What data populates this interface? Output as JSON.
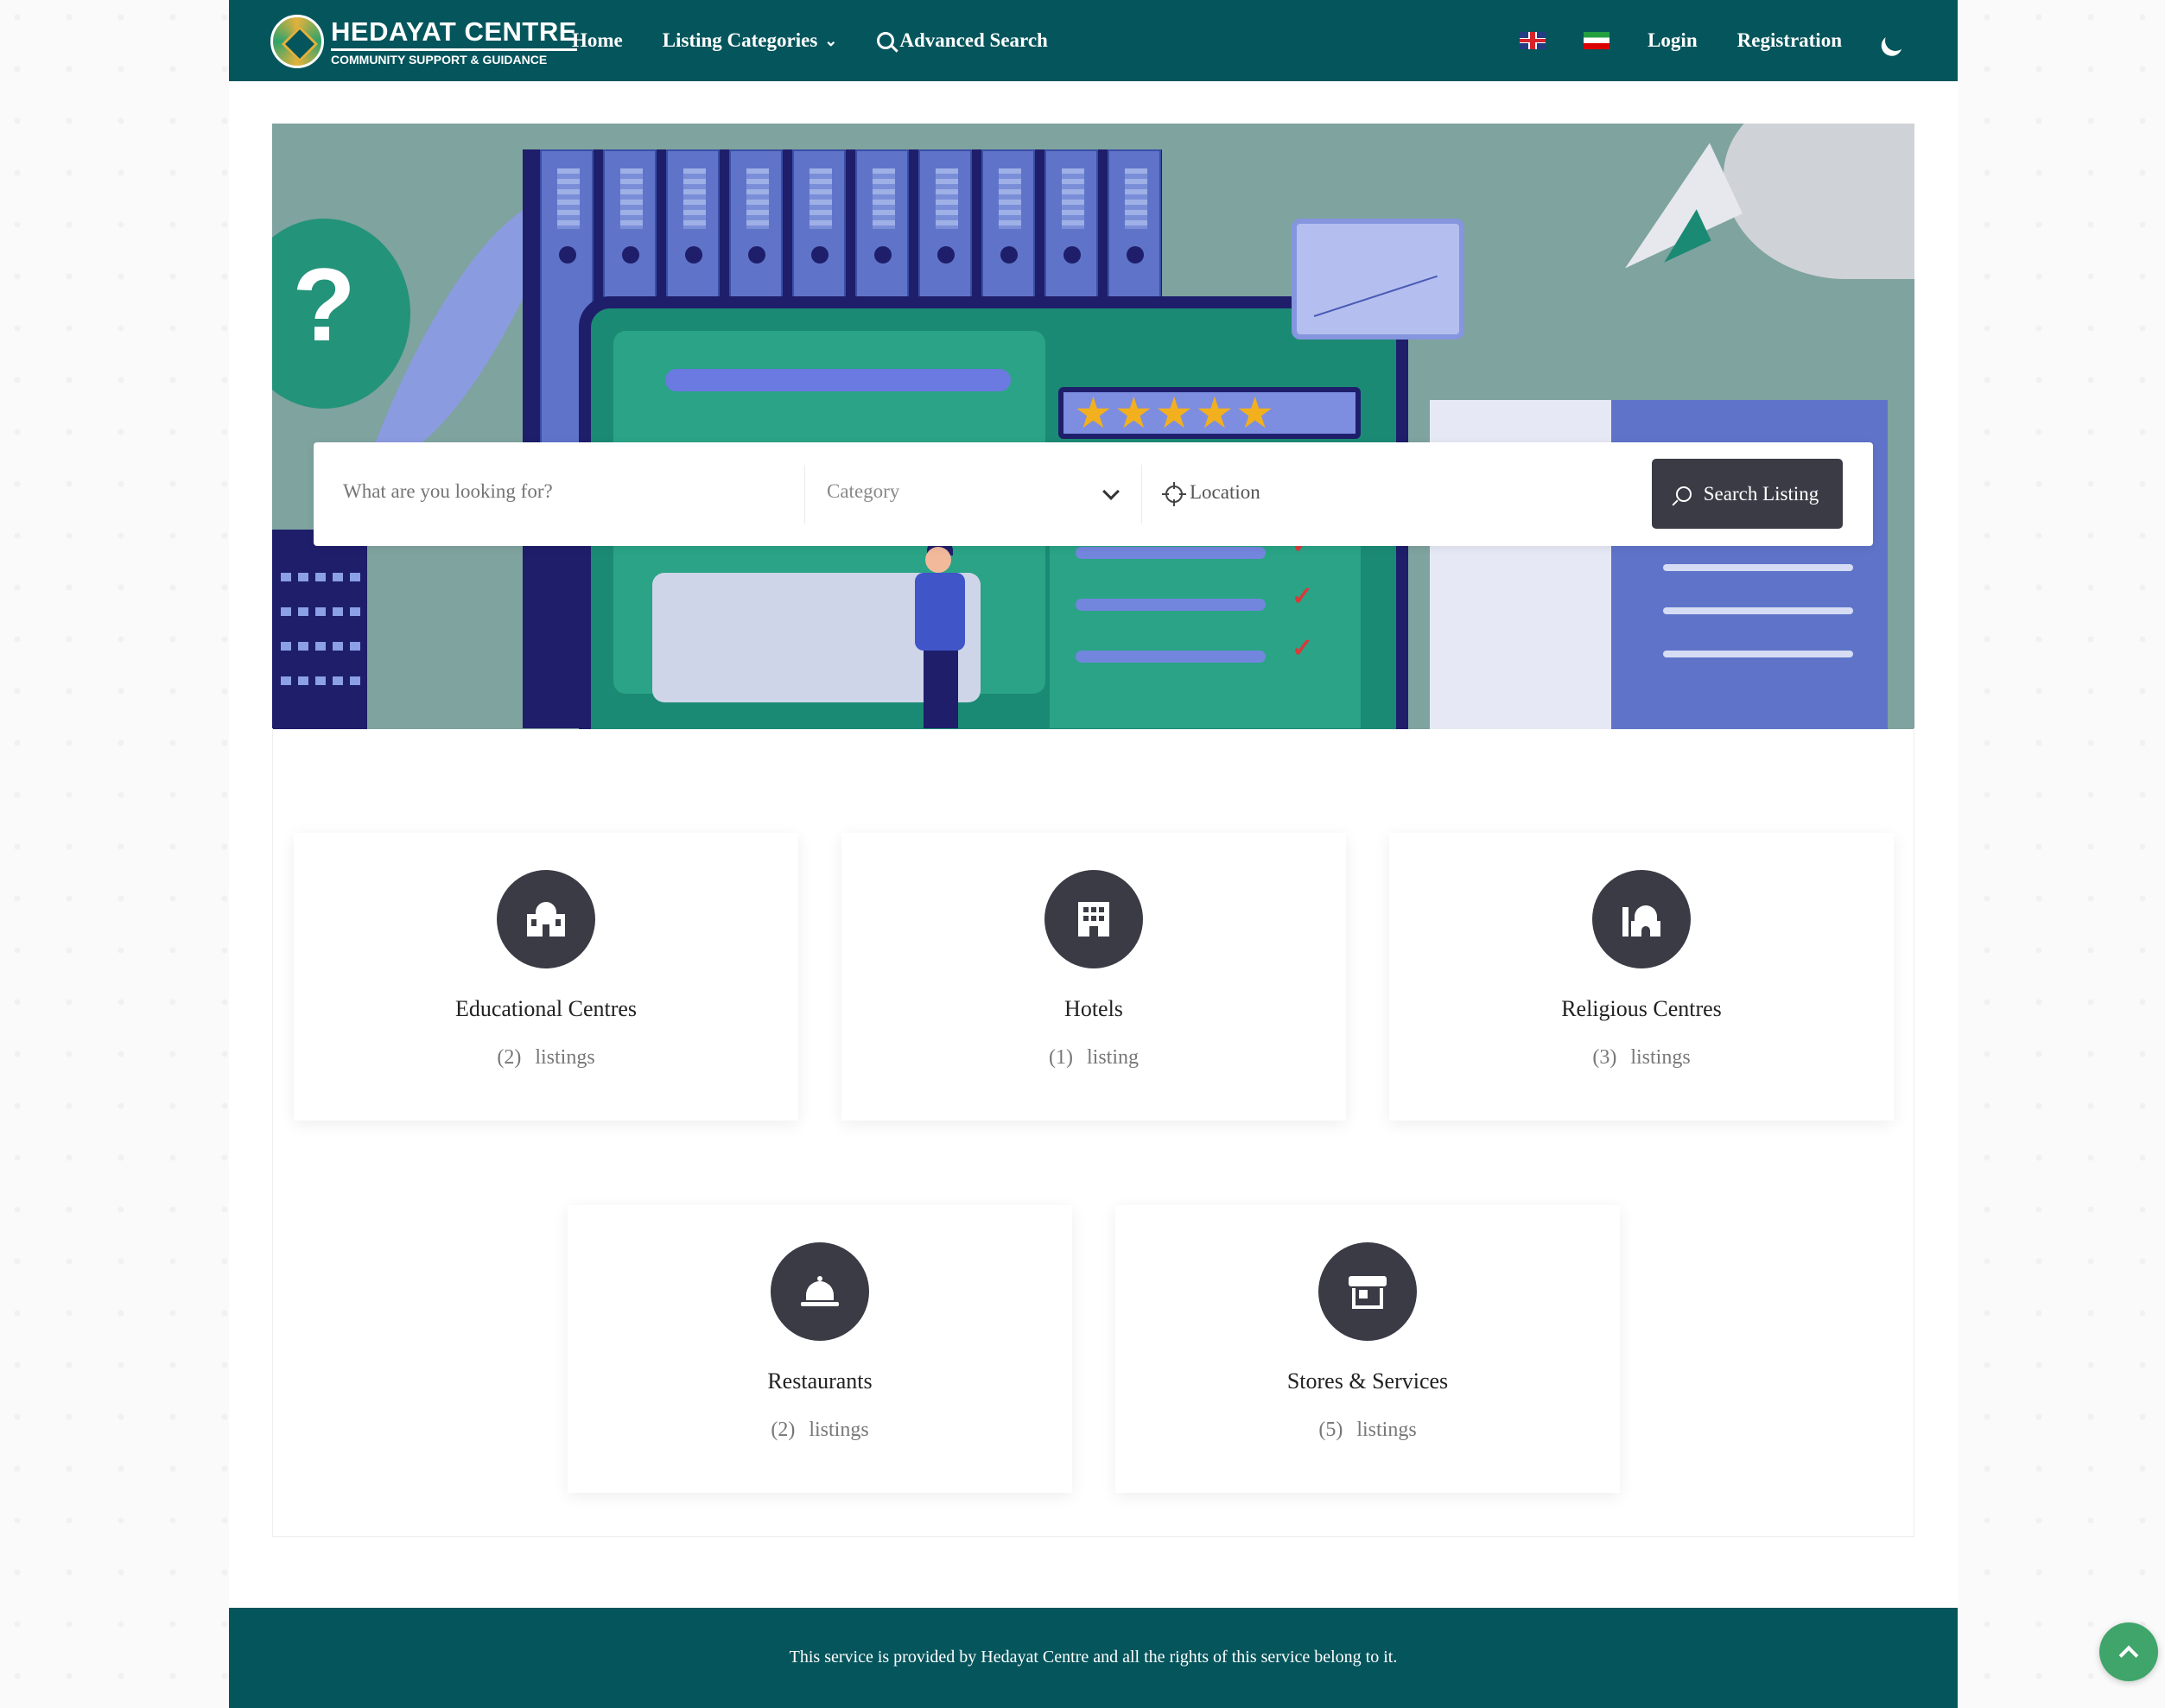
{
  "brand": {
    "title": "HEDAYAT CENTRE",
    "subtitle": "COMMUNITY SUPPORT & GUIDANCE"
  },
  "nav": {
    "home": "Home",
    "listing_categories": "Listing Categories",
    "advanced_search": "Advanced Search",
    "login": "Login",
    "registration": "Registration",
    "icons": [
      "flag-uk-icon",
      "flag-iran-icon",
      "moon-icon"
    ]
  },
  "search": {
    "keyword_placeholder": "What are you looking for?",
    "category_label": "Category",
    "location_label": "Location",
    "button_label": "Search Listing"
  },
  "categories": [
    {
      "name": "Educational Centres",
      "count": "(2)",
      "unit": "listings",
      "icon": "school-icon"
    },
    {
      "name": "Hotels",
      "count": "(1)",
      "unit": "listing",
      "icon": "hotel-icon"
    },
    {
      "name": "Religious Centres",
      "count": "(3)",
      "unit": "listings",
      "icon": "mosque-icon"
    },
    {
      "name": "Restaurants",
      "count": "(2)",
      "unit": "listings",
      "icon": "concierge-bell-icon"
    },
    {
      "name": "Stores & Services",
      "count": "(5)",
      "unit": "listings",
      "icon": "store-icon"
    }
  ],
  "hero": {
    "rating_stars": "★★★★★"
  },
  "footer": {
    "text": "This service is provided by Hedayat Centre and all the rights of this service belong to it."
  },
  "colors": {
    "primary": "#05555c",
    "dark_button": "#3a3b45",
    "scroll_top": "#3fa56b"
  }
}
